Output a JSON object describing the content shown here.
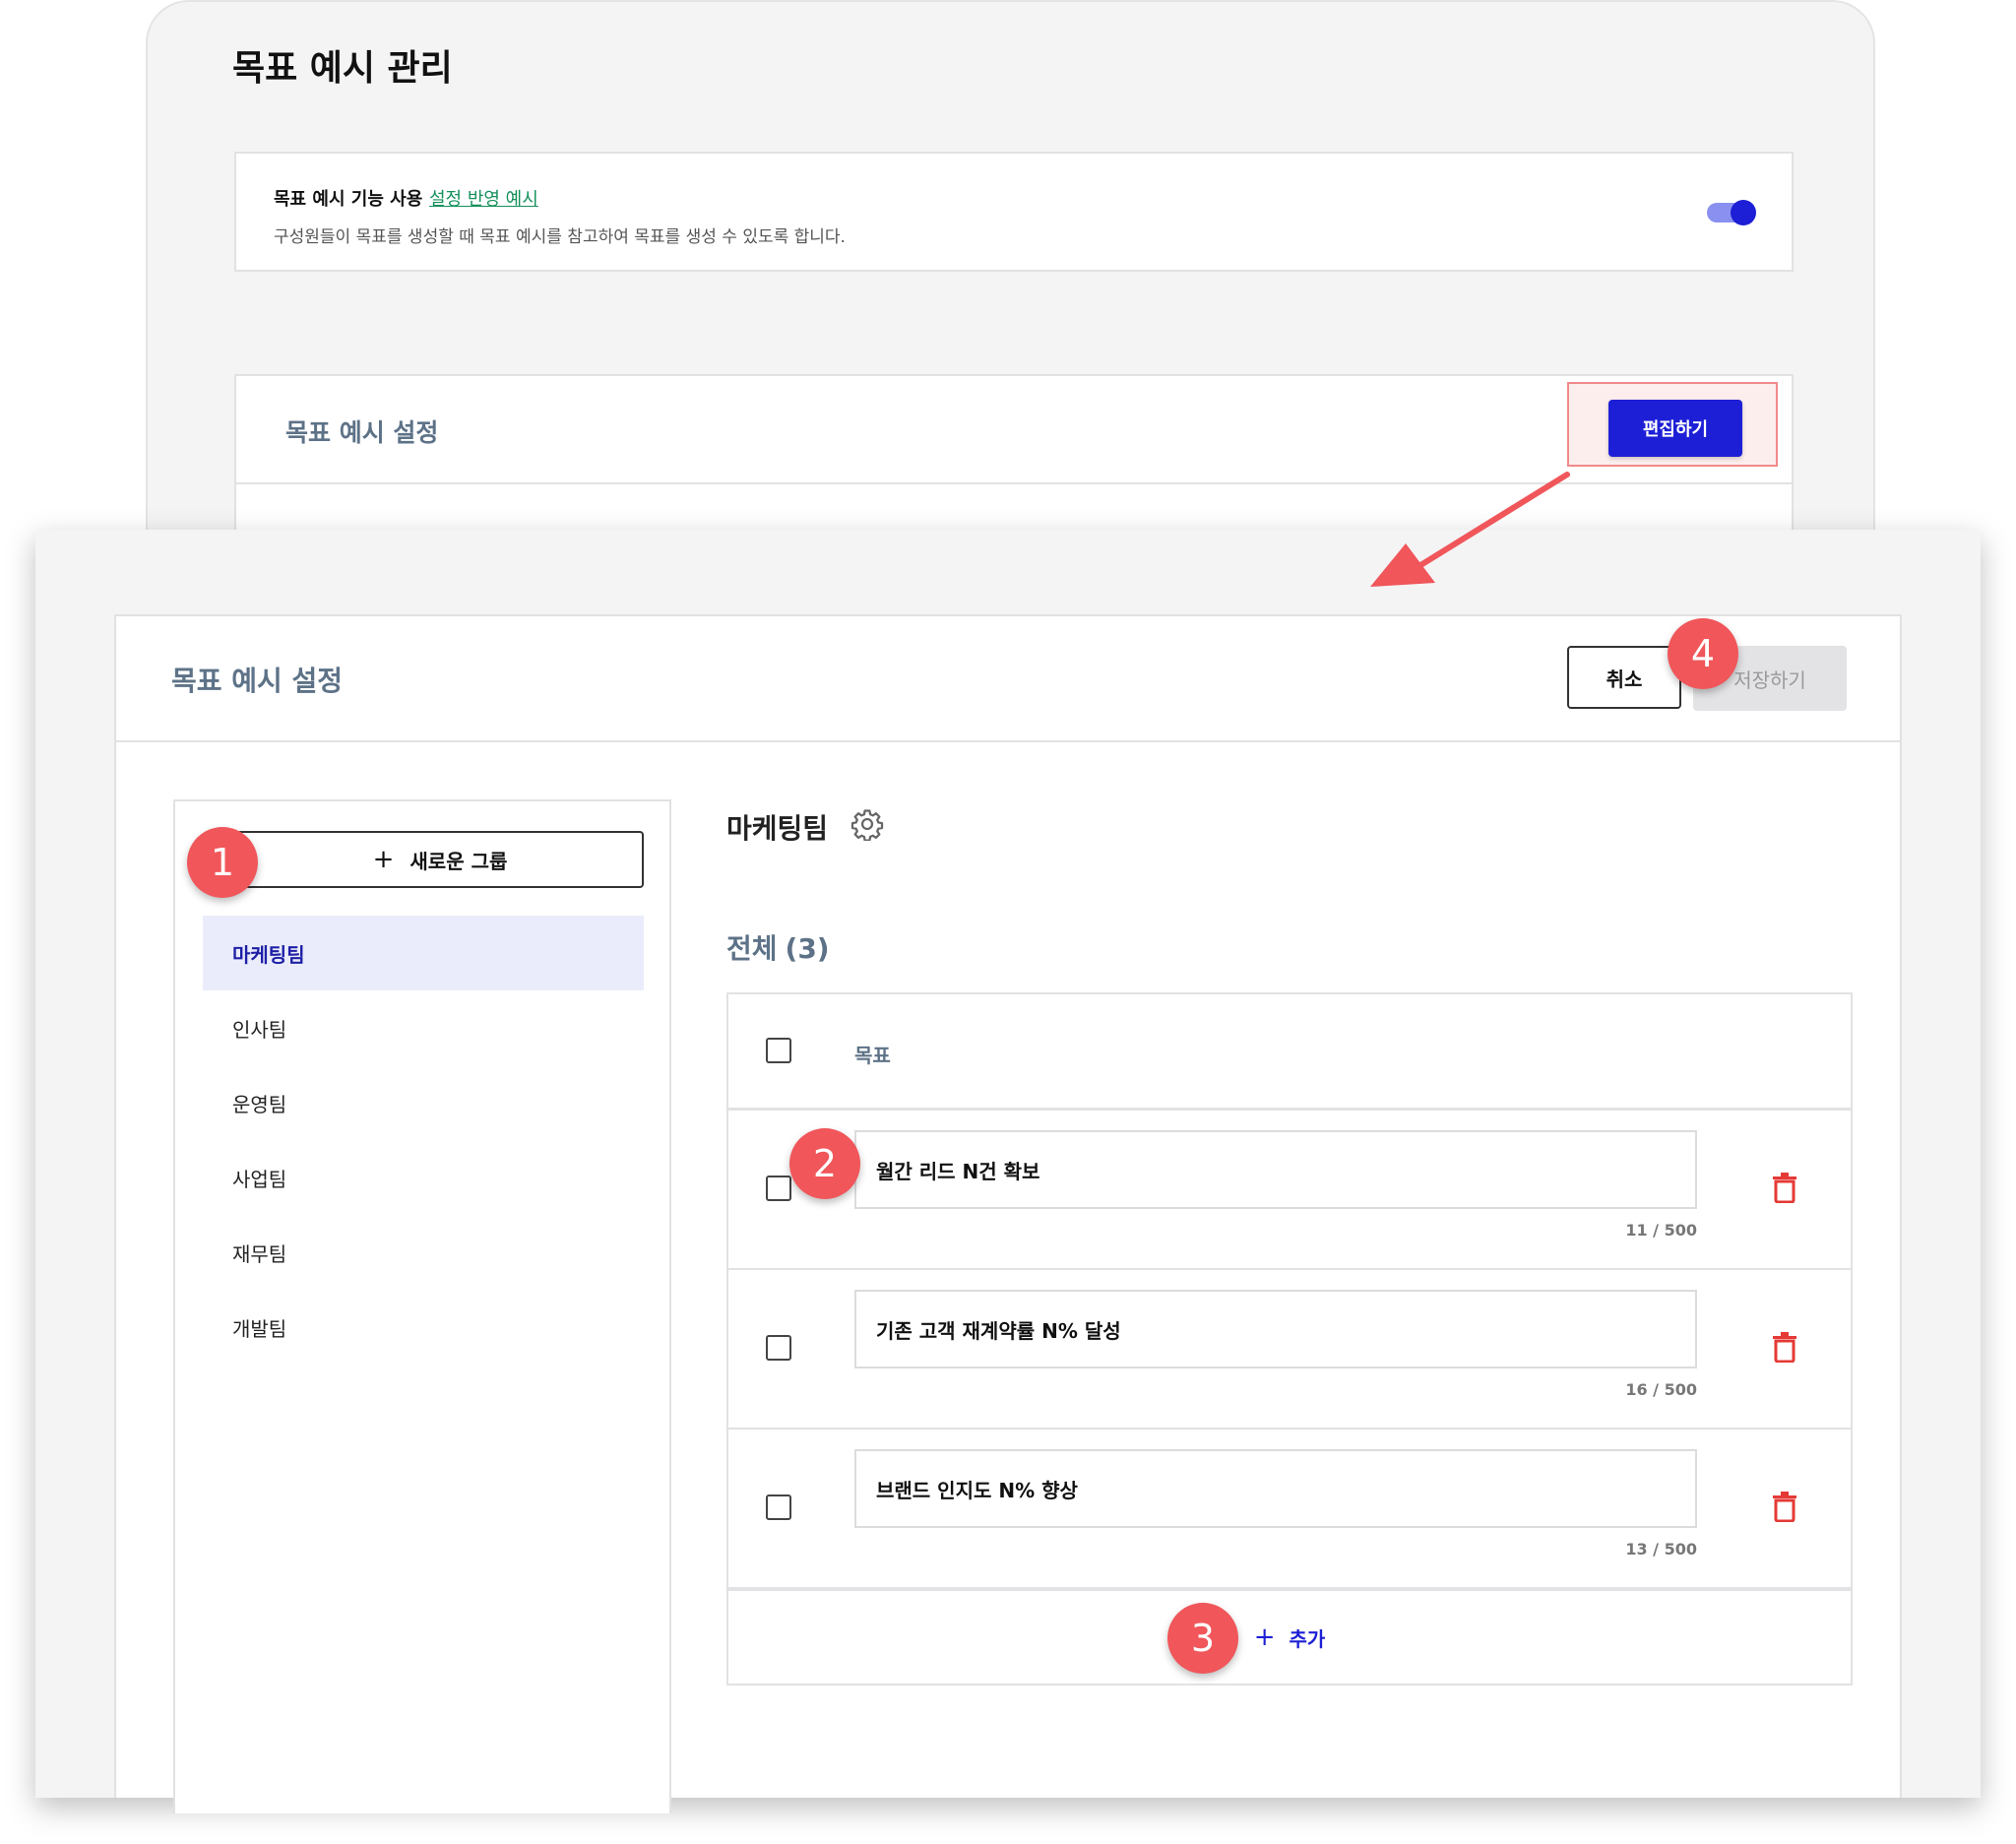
{
  "background": {
    "title": "목표 예시 관리",
    "feature": {
      "label": "목표 예시 기능 사용",
      "link": "설정 반영 예시",
      "description": "구성원들이 목표를 생성할 때 목표 예시를 참고하여 목표를 생성 수 있도록 합니다.",
      "enabled": true
    },
    "settings_title": "목표 예시 설정",
    "edit_button": "편집하기"
  },
  "editor": {
    "title": "목표 예시 설정",
    "cancel_button": "취소",
    "save_button": "저장하기",
    "new_group_button": "새로운 그룹",
    "groups": [
      {
        "label": "마케팅팀",
        "active": true
      },
      {
        "label": "인사팀",
        "active": false
      },
      {
        "label": "운영팀",
        "active": false
      },
      {
        "label": "사업팀",
        "active": false
      },
      {
        "label": "재무팀",
        "active": false
      },
      {
        "label": "개발팀",
        "active": false
      }
    ],
    "selected_group": "마케팅팀",
    "total_label": "전체",
    "total_count": "(3)",
    "column_header": "목표",
    "goals": [
      {
        "text": "월간 리드 N건 확보",
        "counter": "11 / 500"
      },
      {
        "text": "기존 고객 재계약률 N% 달성",
        "counter": "16 / 500"
      },
      {
        "text": "브랜드 인지도 N% 향상",
        "counter": "13 / 500"
      }
    ],
    "add_button": "추가"
  },
  "badges": [
    "1",
    "2",
    "3",
    "4"
  ],
  "colors": {
    "primary": "#1d1fd6",
    "danger": "#e53935",
    "badge": "#f0565a",
    "link": "#14915a",
    "muted_heading": "#5d7287"
  }
}
